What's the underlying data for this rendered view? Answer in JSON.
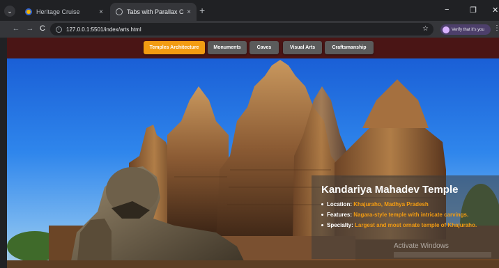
{
  "browser": {
    "tabs": [
      {
        "title": "Heritage Cruise",
        "close": "×"
      },
      {
        "title": "Tabs with Parallax Carousel",
        "close": "×"
      }
    ],
    "new_tab": "+",
    "window_controls": {
      "minimize": "−",
      "restore": "❐",
      "close": "✕"
    },
    "nav": {
      "back": "←",
      "forward": "→",
      "reload": "C"
    },
    "url": "127.0.0.1:5501/index/arts.html",
    "star": "☆",
    "profile_button": "Verify that it's you",
    "menu": "⋮"
  },
  "page": {
    "nav_tabs": [
      {
        "label": "Temples Architecture",
        "active": true
      },
      {
        "label": "Monuments",
        "active": false
      },
      {
        "label": "Caves",
        "active": false
      },
      {
        "label": "Visual Arts",
        "active": false
      },
      {
        "label": "Craftsmanship",
        "active": false
      }
    ],
    "caption": {
      "title": "Kandariya Mahadev Temple",
      "items": [
        {
          "key": "Location:",
          "value": "Khajuraho, Madhya Pradesh"
        },
        {
          "key": "Features:",
          "value": "Nagara-style temple with intricate carvings."
        },
        {
          "key": "Specialty:",
          "value": "Largest and most ornate temple of Khajuraho."
        }
      ]
    },
    "watermark": "Activate Windows"
  },
  "colors": {
    "accent": "#f39c12",
    "nav_bg": "#4a1515",
    "button": "#5b5b5b"
  }
}
